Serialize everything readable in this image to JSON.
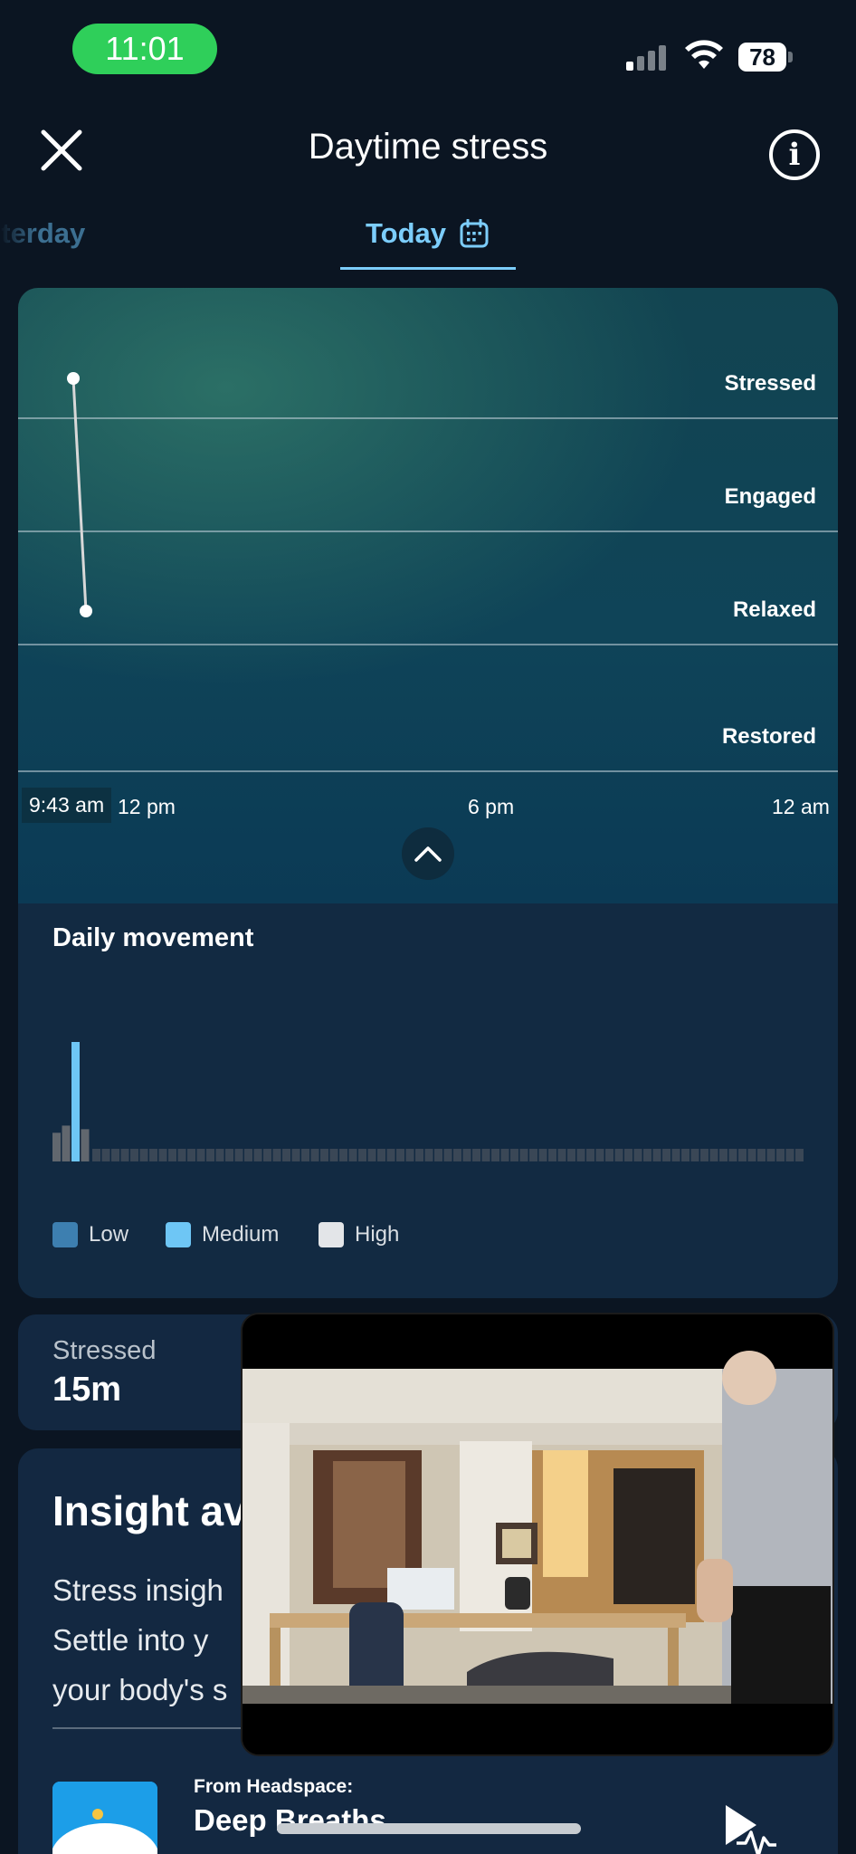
{
  "status_bar": {
    "time": "11:01",
    "battery": "78"
  },
  "header": {
    "title": "Daytime stress"
  },
  "tabs": [
    {
      "label": "sterday"
    },
    {
      "label": "Today"
    }
  ],
  "stress_chart": {
    "levels": [
      "Stressed",
      "Engaged",
      "Relaxed",
      "Restored"
    ],
    "time_labels": [
      "12 pm",
      "6 pm",
      "12 am"
    ],
    "start_time": "9:43 am",
    "colors": {
      "line": "#d8d8d8",
      "point": "#ffffff",
      "accent": "#7ccdfb"
    }
  },
  "chart_data": [
    {
      "type": "line",
      "title": "",
      "x": [
        "9:43 am",
        "9:58 am"
      ],
      "series": [
        {
          "values": [
            "Stressed",
            "Relaxed"
          ]
        }
      ],
      "y_categories": [
        "Restored",
        "Relaxed",
        "Engaged",
        "Stressed"
      ],
      "x_ticks": [
        "12 pm",
        "6 pm",
        "12 am"
      ]
    },
    {
      "type": "bar",
      "title": "Daily movement",
      "bars": [
        {
          "level": "Low",
          "relative_height": 0.24
        },
        {
          "level": "Low",
          "relative_height": 0.3
        },
        {
          "level": "Medium",
          "relative_height": 1.0
        },
        {
          "level": "Low",
          "relative_height": 0.27
        }
      ],
      "legend": [
        "Low",
        "Medium",
        "High"
      ],
      "legend_colors": [
        "#3d7fb0",
        "#6ec6f5",
        "#e3e5e8"
      ]
    }
  ],
  "movement": {
    "title": "Daily movement",
    "legend": [
      {
        "label": "Low",
        "color": "#3d7fb0"
      },
      {
        "label": "Medium",
        "color": "#6ec6f5"
      },
      {
        "label": "High",
        "color": "#e3e5e8"
      }
    ]
  },
  "summary": {
    "stressed_label": "Stressed",
    "stressed_value": "15m"
  },
  "insight": {
    "title": "Insight av",
    "lines": [
      "Stress insigh",
      "Settle into y",
      "your body's s"
    ],
    "headspace_from": "From Headspace:",
    "headspace_title": "Deep Breaths"
  }
}
